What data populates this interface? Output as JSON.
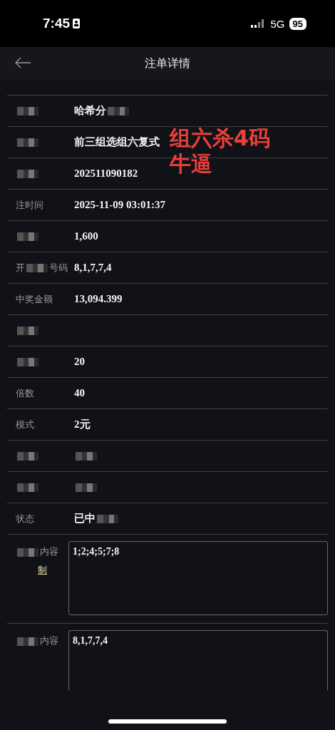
{
  "status_bar": {
    "time": "7:45",
    "network": "5G",
    "battery": "95"
  },
  "header": {
    "title": "注单详情"
  },
  "rows": [
    {
      "kind": "text",
      "label": [
        {
          "kind": "mosaic"
        }
      ],
      "value": [
        {
          "kind": "text",
          "text": "哈希分"
        },
        {
          "kind": "mosaic"
        }
      ]
    },
    {
      "kind": "text",
      "label": [
        {
          "kind": "mosaic"
        }
      ],
      "value": [
        {
          "kind": "text",
          "text": "前三组选组六复式"
        }
      ]
    },
    {
      "kind": "text",
      "label": [
        {
          "kind": "mosaic"
        }
      ],
      "value": [
        {
          "kind": "text",
          "text": "202511090182"
        }
      ]
    },
    {
      "kind": "text",
      "label": [
        {
          "kind": "text",
          "text": "注时间"
        }
      ],
      "value": [
        {
          "kind": "text",
          "text": "2025-11-09 03:01:37"
        }
      ]
    },
    {
      "kind": "text",
      "label": [
        {
          "kind": "mosaic"
        }
      ],
      "value": [
        {
          "kind": "text",
          "text": "1,600"
        }
      ]
    },
    {
      "kind": "text",
      "label": [
        {
          "kind": "text",
          "text": "开"
        },
        {
          "kind": "mosaic"
        },
        {
          "kind": "text",
          "text": "号码"
        }
      ],
      "value": [
        {
          "kind": "text",
          "text": "8,1,7,7,4"
        }
      ]
    },
    {
      "kind": "text",
      "label": [
        {
          "kind": "text",
          "text": "中奖金额"
        }
      ],
      "value": [
        {
          "kind": "text",
          "text": "13,094.399"
        }
      ]
    },
    {
      "kind": "text",
      "label": [
        {
          "kind": "mosaic"
        }
      ],
      "value": []
    },
    {
      "kind": "text",
      "label": [
        {
          "kind": "mosaic"
        }
      ],
      "value": [
        {
          "kind": "text",
          "text": "20"
        }
      ]
    },
    {
      "kind": "text",
      "label": [
        {
          "kind": "text",
          "text": "倍数"
        }
      ],
      "value": [
        {
          "kind": "text",
          "text": "40"
        }
      ]
    },
    {
      "kind": "text",
      "label": [
        {
          "kind": "text",
          "text": "模式"
        }
      ],
      "value": [
        {
          "kind": "text",
          "text": "2元"
        }
      ]
    },
    {
      "kind": "text",
      "label": [
        {
          "kind": "mosaic"
        }
      ],
      "value": [
        {
          "kind": "mosaic"
        }
      ]
    },
    {
      "kind": "text",
      "label": [
        {
          "kind": "mosaic"
        }
      ],
      "value": [
        {
          "kind": "mosaic"
        }
      ]
    },
    {
      "kind": "text",
      "label": [
        {
          "kind": "text",
          "text": "状态"
        }
      ],
      "value": [
        {
          "kind": "text",
          "text": "已中"
        },
        {
          "kind": "mosaic"
        }
      ]
    },
    {
      "kind": "box",
      "label": [
        {
          "kind": "mosaic"
        },
        {
          "kind": "text",
          "text": "内容"
        }
      ],
      "link": "制",
      "content": "1;2;4;5;7;8"
    },
    {
      "kind": "box",
      "label": [
        {
          "kind": "mosaic"
        },
        {
          "kind": "text",
          "text": "内容"
        }
      ],
      "content": "8,1,7,7,4",
      "cut": true
    }
  ],
  "overlay": {
    "lines": [
      "组六杀4码",
      "牛逼"
    ],
    "color": "#e8403a"
  }
}
